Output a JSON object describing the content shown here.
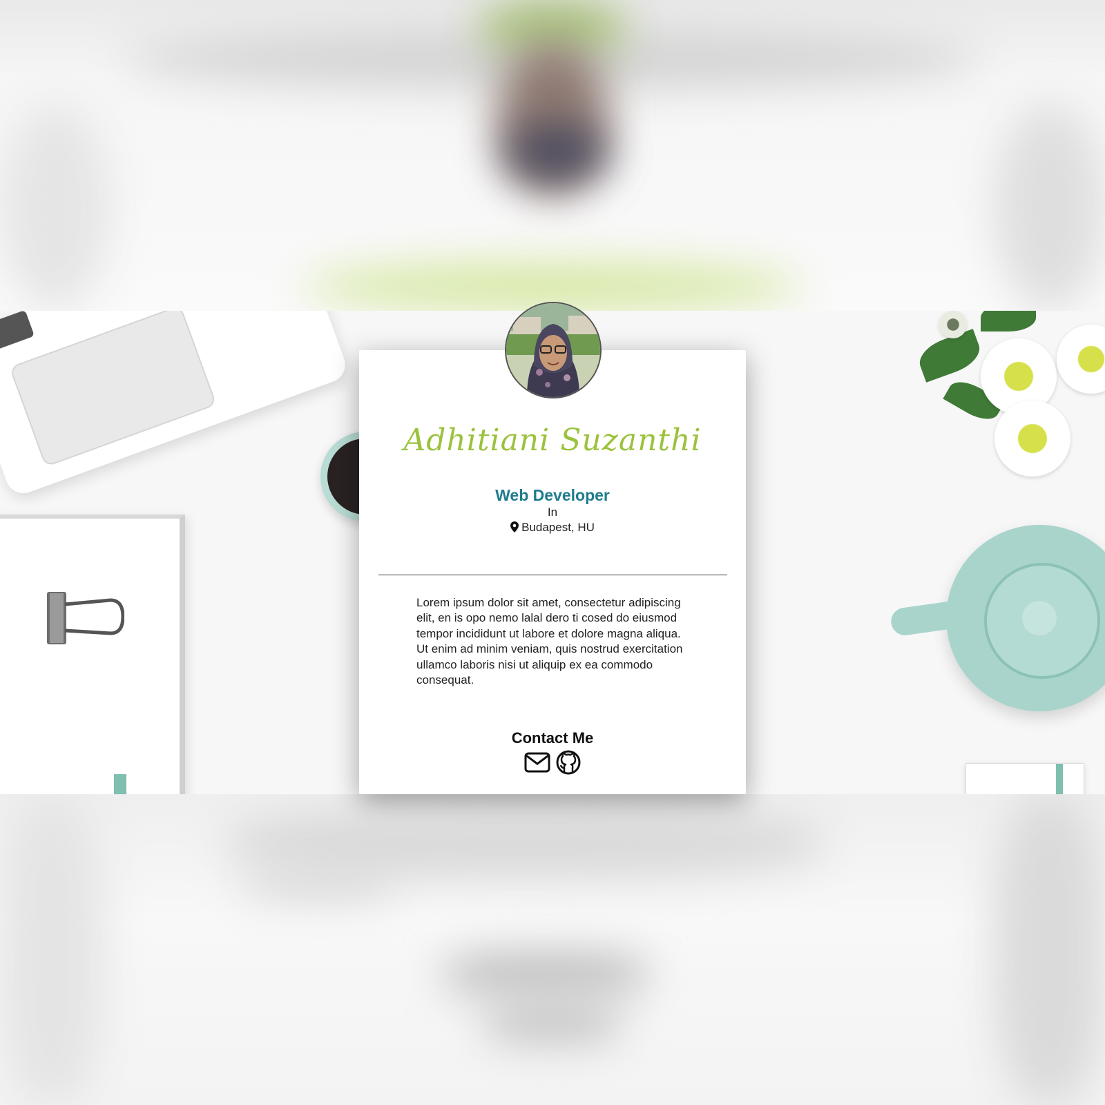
{
  "profile": {
    "name": "Adhitiani Suzanthi",
    "role": "Web Developer",
    "in_text": "In",
    "location": "Budapest, HU",
    "bio": "Lorem ipsum dolor sit amet, consectetur adipiscing elit, en is opo nemo lalal dero ti cosed do eiusmod tempor incididunt ut labore et dolore magna aliqua. Ut enim ad minim veniam, quis nostrud exercitation ullamco laboris nisi ut aliquip ex ea commodo consequat."
  },
  "contact": {
    "title": "Contact Me",
    "icons": [
      "envelope-icon",
      "github-icon"
    ]
  },
  "colors": {
    "name_green": "#9bc23c",
    "role_teal": "#1e7c8c",
    "card_bg": "#ffffff"
  }
}
